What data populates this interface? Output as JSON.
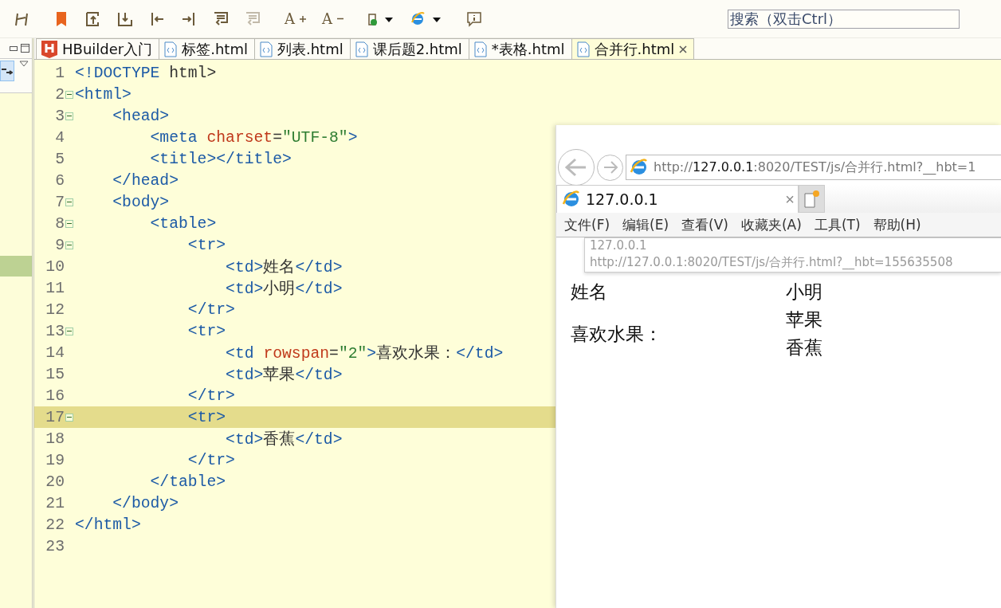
{
  "toolbar": {
    "groups": [
      [
        {
          "kind": "compare",
          "disabled": false
        }
      ],
      [
        {
          "kind": "bookmark",
          "disabled": false
        },
        {
          "kind": "export-up",
          "disabled": false
        },
        {
          "kind": "import-down",
          "disabled": false
        },
        {
          "kind": "indent-left",
          "disabled": false
        },
        {
          "kind": "indent-right",
          "disabled": false
        },
        {
          "kind": "format",
          "disabled": false
        },
        {
          "kind": "format",
          "disabled": true
        }
      ],
      [
        {
          "kind": "font-bigger",
          "label": "A",
          "disabled": false
        },
        {
          "kind": "font-smaller",
          "label": "A",
          "disabled": false
        }
      ],
      [
        {
          "kind": "run-menu",
          "disabled": false
        },
        {
          "kind": "browser-menu",
          "disabled": false
        }
      ],
      [
        {
          "kind": "comment",
          "disabled": false
        }
      ]
    ],
    "search": {
      "placeholder": "搜索（双击Ctrl）"
    }
  },
  "tabs": [
    {
      "kind": "hbuilder",
      "label": "HBuilder入门",
      "selected": false
    },
    {
      "kind": "html",
      "label": "标签.html",
      "selected": false
    },
    {
      "kind": "html",
      "label": "列表.html",
      "selected": false
    },
    {
      "kind": "html",
      "label": "课后题2.html",
      "selected": false
    },
    {
      "kind": "html",
      "label": "*表格.html",
      "selected": false
    },
    {
      "kind": "html",
      "label": "合并行.html",
      "selected": true
    }
  ],
  "editor": {
    "lines": [
      {
        "num": "1",
        "fold": false,
        "current": false,
        "tokens": [
          {
            "kind": "tag",
            "text": "<!DOCTYPE"
          },
          {
            "kind": "text",
            "text": " html>"
          }
        ]
      },
      {
        "num": "2",
        "fold": true,
        "current": false,
        "tokens": [
          {
            "kind": "tag",
            "text": "<html>"
          }
        ]
      },
      {
        "num": "3",
        "fold": true,
        "current": false,
        "tokens": [
          {
            "kind": "tag",
            "text": "    <head>"
          }
        ]
      },
      {
        "num": "4",
        "fold": false,
        "current": false,
        "tokens": [
          {
            "kind": "tag",
            "text": "        <meta "
          },
          {
            "kind": "attr",
            "text": "charset"
          },
          {
            "kind": "text",
            "text": "="
          },
          {
            "kind": "string",
            "text": "\"UTF-8\""
          },
          {
            "kind": "tag",
            "text": ">"
          }
        ]
      },
      {
        "num": "5",
        "fold": false,
        "current": false,
        "tokens": [
          {
            "kind": "tag",
            "text": "        <title></title>"
          }
        ]
      },
      {
        "num": "6",
        "fold": false,
        "current": false,
        "tokens": [
          {
            "kind": "tag",
            "text": "    </head>"
          }
        ]
      },
      {
        "num": "7",
        "fold": true,
        "current": false,
        "tokens": [
          {
            "kind": "tag",
            "text": "    <body>"
          }
        ]
      },
      {
        "num": "8",
        "fold": true,
        "current": false,
        "tokens": [
          {
            "kind": "tag",
            "text": "        <table>"
          }
        ]
      },
      {
        "num": "9",
        "fold": true,
        "current": false,
        "tokens": [
          {
            "kind": "tag",
            "text": "            <tr>"
          }
        ]
      },
      {
        "num": "10",
        "fold": false,
        "current": false,
        "tokens": [
          {
            "kind": "tag",
            "text": "                <td>"
          },
          {
            "kind": "text",
            "text": "姓名"
          },
          {
            "kind": "tag",
            "text": "</td>"
          }
        ]
      },
      {
        "num": "11",
        "fold": false,
        "current": false,
        "tokens": [
          {
            "kind": "tag",
            "text": "                <td>"
          },
          {
            "kind": "text",
            "text": "小明"
          },
          {
            "kind": "tag",
            "text": "</td>"
          }
        ]
      },
      {
        "num": "12",
        "fold": false,
        "current": false,
        "tokens": [
          {
            "kind": "tag",
            "text": "            </tr>"
          }
        ]
      },
      {
        "num": "13",
        "fold": true,
        "current": false,
        "tokens": [
          {
            "kind": "tag",
            "text": "            <tr>"
          }
        ]
      },
      {
        "num": "14",
        "fold": false,
        "current": false,
        "tokens": [
          {
            "kind": "tag",
            "text": "                <td "
          },
          {
            "kind": "attr",
            "text": "rowspan"
          },
          {
            "kind": "text",
            "text": "="
          },
          {
            "kind": "string",
            "text": "\"2\""
          },
          {
            "kind": "tag",
            "text": ">"
          },
          {
            "kind": "text",
            "text": "喜欢水果："
          },
          {
            "kind": "tag",
            "text": "</td>"
          }
        ]
      },
      {
        "num": "15",
        "fold": false,
        "current": false,
        "tokens": [
          {
            "kind": "tag",
            "text": "                <td>"
          },
          {
            "kind": "text",
            "text": "苹果"
          },
          {
            "kind": "tag",
            "text": "</td>"
          }
        ]
      },
      {
        "num": "16",
        "fold": false,
        "current": false,
        "tokens": [
          {
            "kind": "tag",
            "text": "            </tr>"
          }
        ]
      },
      {
        "num": "17",
        "fold": true,
        "current": true,
        "tokens": [
          {
            "kind": "tag",
            "text": "            <tr>"
          }
        ]
      },
      {
        "num": "18",
        "fold": false,
        "current": false,
        "tokens": [
          {
            "kind": "tag",
            "text": "                <td>"
          },
          {
            "kind": "text",
            "text": "香蕉"
          },
          {
            "kind": "tag",
            "text": "</td>"
          }
        ]
      },
      {
        "num": "19",
        "fold": false,
        "current": false,
        "tokens": [
          {
            "kind": "tag",
            "text": "            </tr>"
          }
        ]
      },
      {
        "num": "20",
        "fold": false,
        "current": false,
        "tokens": [
          {
            "kind": "tag",
            "text": "        </table>"
          }
        ]
      },
      {
        "num": "21",
        "fold": false,
        "current": false,
        "tokens": [
          {
            "kind": "tag",
            "text": "    </body>"
          }
        ]
      },
      {
        "num": "22",
        "fold": false,
        "current": false,
        "tokens": [
          {
            "kind": "tag",
            "text": "</html>"
          }
        ]
      },
      {
        "num": "23",
        "fold": false,
        "current": false
      }
    ]
  },
  "browser": {
    "address": {
      "scheme": "http://",
      "host": "127.0.0.1",
      "path": ":8020/TEST/js/合并行.html?__hbt=1"
    },
    "tab": {
      "title": "127.0.0.1",
      "close": "×"
    },
    "menu": [
      "文件(F)",
      "编辑(E)",
      "查看(V)",
      "收藏夹(A)",
      "工具(T)",
      "帮助(H)"
    ],
    "suggestion": {
      "title": "127.0.0.1",
      "url": "http://127.0.0.1:8020/TEST/js/合并行.html?__hbt=155635508"
    },
    "table": [
      {
        "cells": [
          {
            "text": "姓名",
            "rowspan": false
          },
          {
            "text": "小明",
            "rowspan": false
          }
        ]
      },
      {
        "cells": [
          {
            "text": "喜欢水果：",
            "rowspan": true
          },
          {
            "text": "苹果",
            "rowspan": false
          }
        ]
      },
      {
        "cells": [
          {
            "text": "香蕉",
            "rowspan": false
          }
        ]
      }
    ]
  }
}
